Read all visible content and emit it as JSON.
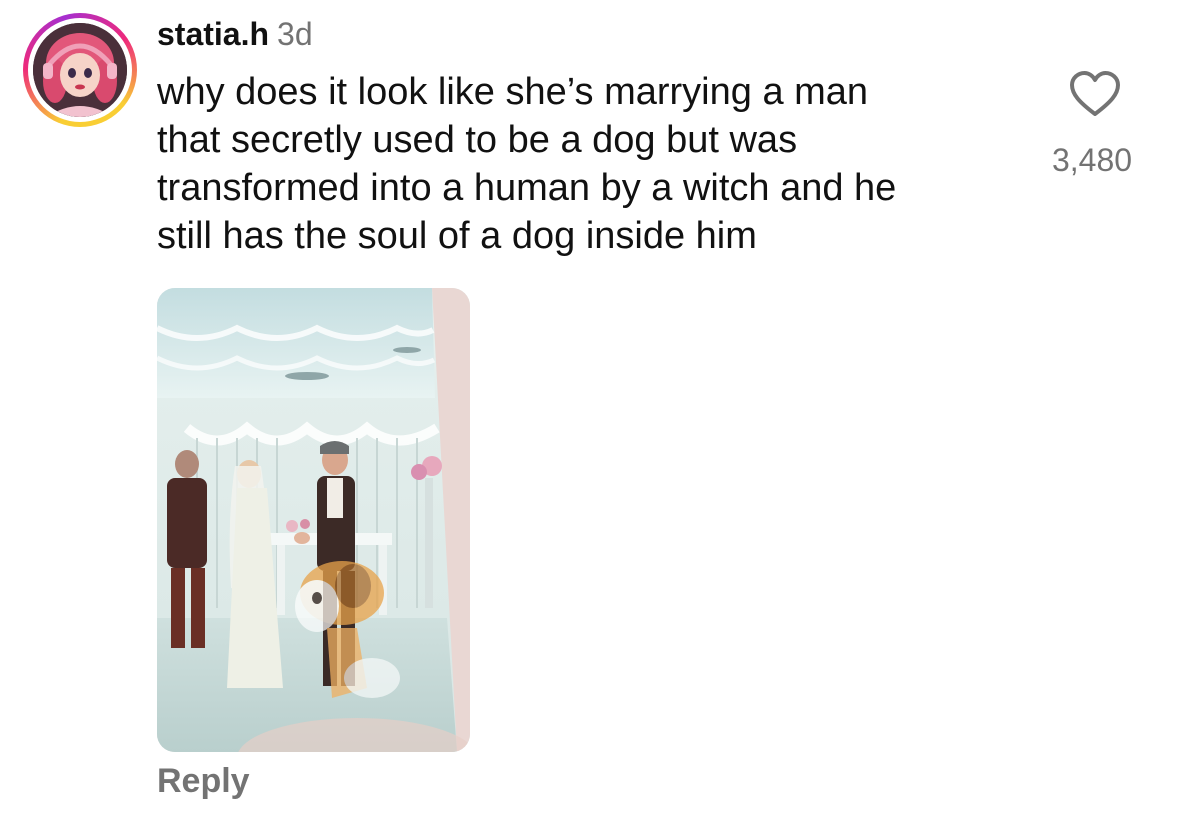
{
  "comment": {
    "username": "statia.h",
    "timestamp": "3d",
    "text_lines": [
      "why does it look like she’s marrying a man",
      "that secretly used to be a dog but was",
      "transformed into a human by a witch and he",
      "still has the soul of a dog inside him"
    ],
    "like_count": "3,480",
    "reply_label": "Reply",
    "avatar_icon": "cartoon-doll-avatar",
    "like_icon": "heart-outline-icon"
  },
  "colors": {
    "text_primary": "#111111",
    "text_secondary": "#737373",
    "story_ring": [
      "#f9ce34",
      "#ee2a7b",
      "#a62fd0"
    ]
  }
}
